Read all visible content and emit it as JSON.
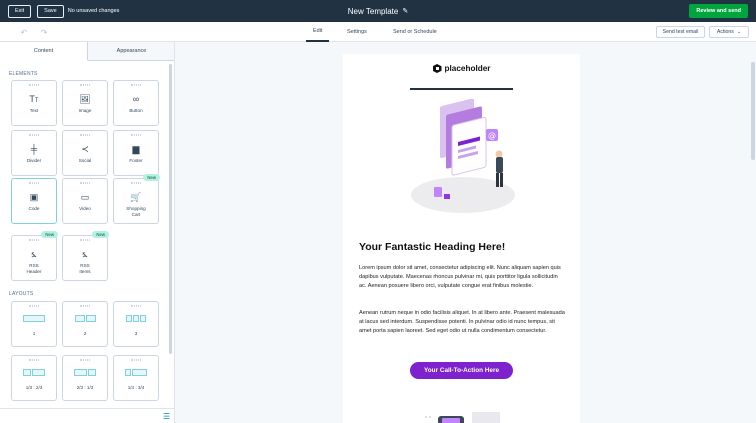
{
  "topbar": {
    "exit_label": "Exit",
    "save_label": "Save",
    "status": "No unsaved changes",
    "title": "New Template",
    "edit_icon": "pencil-icon",
    "review_label": "Review and send"
  },
  "subbar": {
    "tabs": [
      {
        "label": "Edit",
        "active": true
      },
      {
        "label": "Settings",
        "active": false
      },
      {
        "label": "Send or Schedule",
        "active": false
      }
    ],
    "send_test_label": "Send test email",
    "actions_label": "Actions"
  },
  "panel": {
    "tabs": [
      {
        "label": "Content",
        "active": true
      },
      {
        "label": "Appearance",
        "active": false
      }
    ],
    "elements_heading": "ELEMENTS",
    "elements": [
      {
        "label": "Text",
        "icon": "text-icon"
      },
      {
        "label": "Image",
        "icon": "image-icon"
      },
      {
        "label": "Button",
        "icon": "link-icon"
      },
      {
        "label": "Divider",
        "icon": "divider-icon"
      },
      {
        "label": "Social",
        "icon": "share-icon"
      },
      {
        "label": "Footer",
        "icon": "footer-icon"
      },
      {
        "label": "Code",
        "icon": "code-icon"
      },
      {
        "label": "Video",
        "icon": "video-icon"
      },
      {
        "label": "Shopping Cart",
        "icon": "cart-icon",
        "badge": "New"
      },
      {
        "label": "RSS Header",
        "icon": "rss-icon",
        "badge": "New"
      },
      {
        "label": "RSS Items",
        "icon": "rss-icon",
        "badge": "New"
      }
    ],
    "layouts_heading": "LAYOUTS",
    "layouts": [
      {
        "label": "1"
      },
      {
        "label": "2"
      },
      {
        "label": "3"
      },
      {
        "label": "1/3 : 2/3"
      },
      {
        "label": "2/3 : 1/3"
      },
      {
        "label": "1/4 : 3/4"
      }
    ]
  },
  "email": {
    "logo_text": "placeholder",
    "heading": "Your Fantastic Heading Here!",
    "paragraph1": "Lorem ipsum dolor sit amet, consectetur adipiscing elit. Nunc aliquam sapien quis dapibus vulputate. Maecenas rhoncus pulvinar mi, quis porttitor ligula sollicitudin ac. Aenean posuere libero orci, vulputate congue erat finibus molestie.",
    "paragraph2": "Aenean rutrum neque in odio facilisis aliquet. In at libero ante. Praesent malesuada at lacus sed interdum. Suspendisse potenti. In pulvinar odio id nunc tempus, sit amet porta sapien laoreet. Sed eget odio ut nulla condimentum consectetur.",
    "cta_label": "Your Call-To-Action Here",
    "cta_color": "#7e22ce"
  },
  "colors": {
    "topbar": "#213343",
    "review": "#00a63d",
    "badge": "#b3f0e0",
    "layout_accent": "#7fd1de"
  }
}
